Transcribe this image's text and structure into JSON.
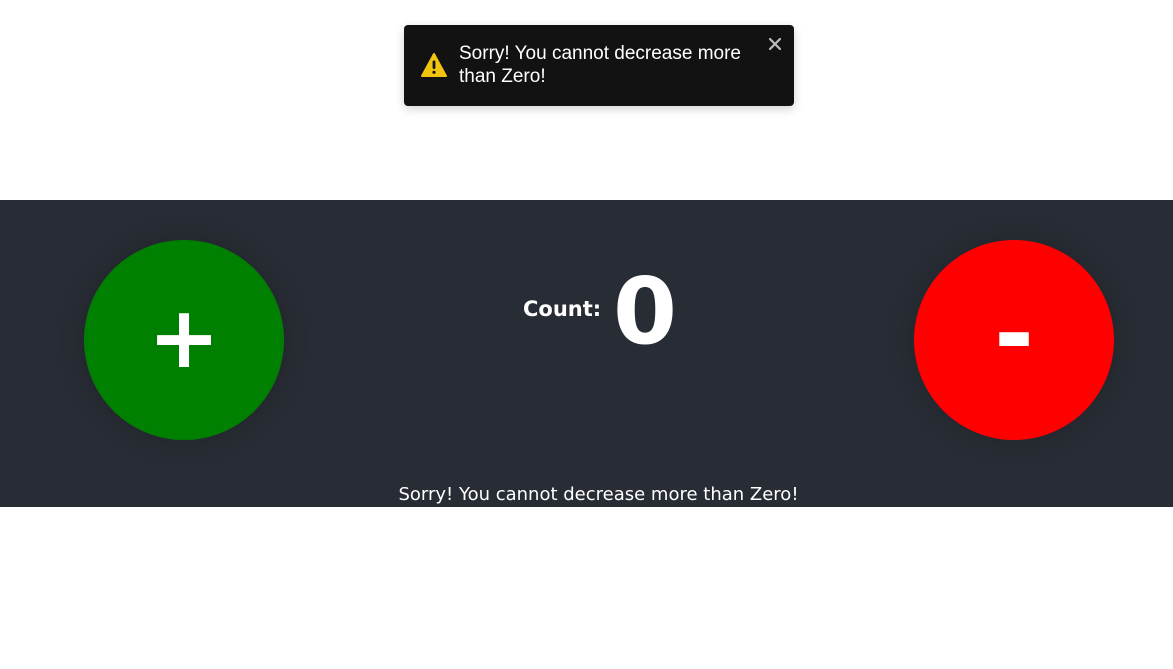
{
  "toast": {
    "message": "Sorry! You cannot decrease more than Zero!",
    "icon": "warning-icon",
    "close_icon": "close-icon",
    "background_color": "#121212",
    "icon_color": "#f1c40f"
  },
  "counter": {
    "increment_label": "+",
    "decrement_label": "-",
    "count_label": "Count:",
    "count_value": "0",
    "error_message": "Sorry! You cannot decrease more than Zero!",
    "increment_color": "#008000",
    "decrement_color": "#ff0000",
    "panel_color": "#282c34"
  }
}
